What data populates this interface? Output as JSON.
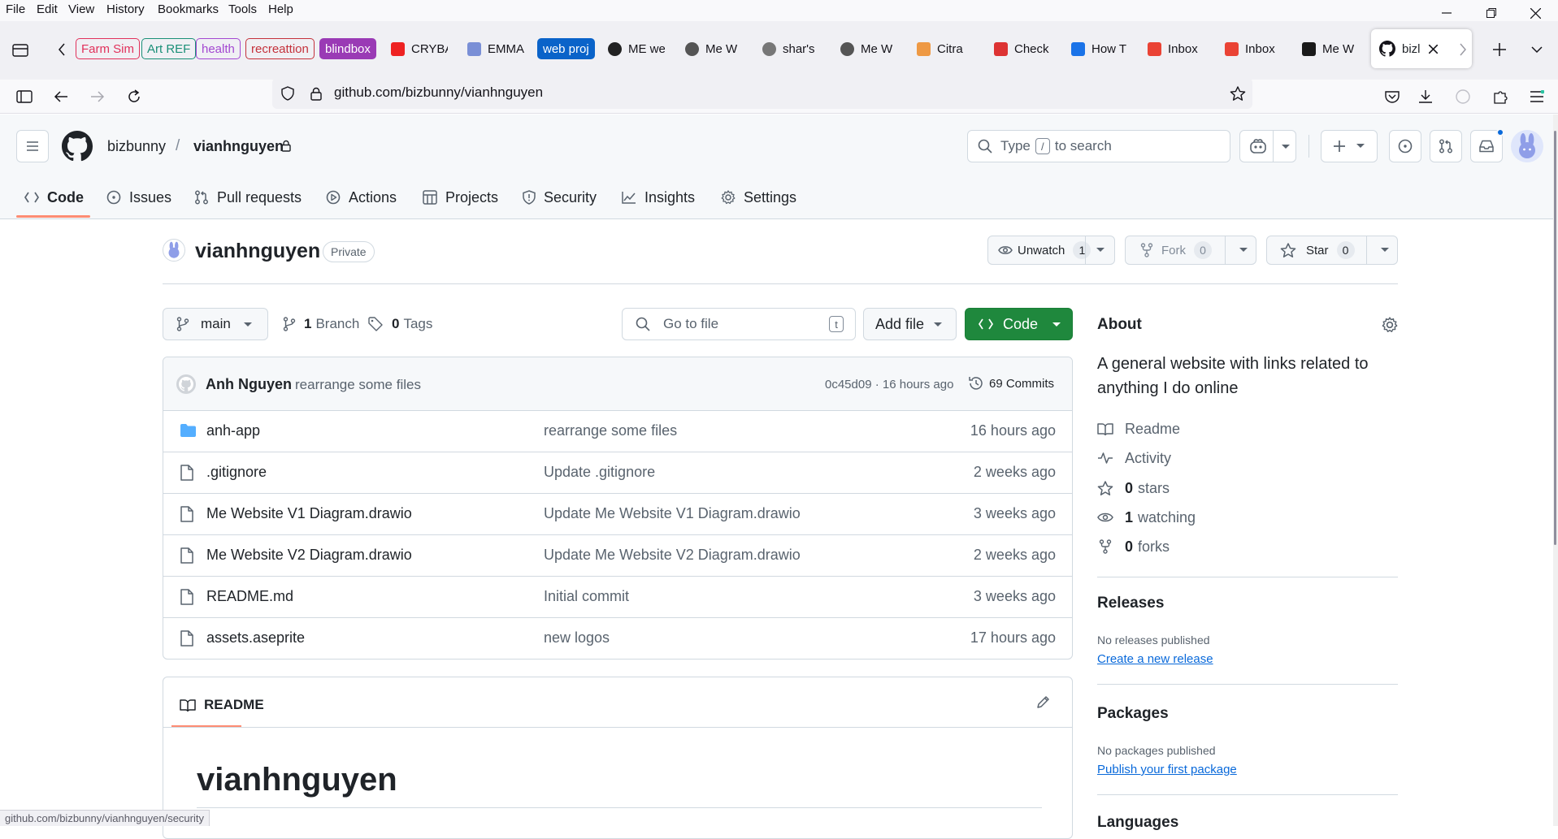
{
  "menu": [
    "File",
    "Edit",
    "View",
    "History",
    "Bookmarks",
    "Tools",
    "Help"
  ],
  "tab_groups": [
    {
      "label": "Farm Sim",
      "color": "#e1315b"
    },
    {
      "label": "Art REF",
      "color": "#1a8f77"
    },
    {
      "label": "health",
      "color": "#a347d1"
    },
    {
      "label": "recreattion",
      "color": "#c4313b"
    },
    {
      "label": "blindbox",
      "color": "#9a3ab5"
    }
  ],
  "tabs": [
    {
      "label": "CRYBA",
      "fav": "#e22"
    },
    {
      "label": "EMMA",
      "fav": "#7a8fd6"
    },
    {
      "label": "ME we",
      "fav": "#222"
    },
    {
      "label": "Me W",
      "fav": "#555"
    },
    {
      "label": "shar's",
      "fav": "#777"
    },
    {
      "label": "Me W",
      "fav": "#555"
    },
    {
      "label": "Citra",
      "fav": "#e94"
    },
    {
      "label": "Check",
      "fav": "#d33"
    },
    {
      "label": "How T",
      "fav": "#1a73e8"
    },
    {
      "label": "Inbox",
      "fav": "#ea4335"
    },
    {
      "label": "Inbox",
      "fav": "#ea4335"
    },
    {
      "label": "Me W",
      "fav": "#1a1a1a"
    }
  ],
  "webproj_group": {
    "label": "web proj",
    "color": "#0a63c9"
  },
  "active_tab": {
    "label": "bizl"
  },
  "url": "github.com/bizbunny/vianhnguyen",
  "status_url": "github.com/bizbunny/vianhnguyen/security",
  "header": {
    "owner": "bizbunny",
    "sep": "/",
    "repo": "vianhnguyen",
    "search_prefix": "Type",
    "search_key": "/",
    "search_suffix": "to search"
  },
  "repo_tabs": [
    "Code",
    "Issues",
    "Pull requests",
    "Actions",
    "Projects",
    "Security",
    "Insights",
    "Settings"
  ],
  "repo": {
    "name": "vianhnguyen",
    "visibility": "Private",
    "unwatch": "Unwatch",
    "watch_count": "1",
    "fork": "Fork",
    "fork_count": "0",
    "star": "Star",
    "star_count": "0"
  },
  "branch_bar": {
    "branch": "main",
    "branch_count": "1",
    "branch_label": "Branch",
    "tag_count": "0",
    "tag_label": "Tags",
    "goto_placeholder": "Go to file",
    "goto_key": "t",
    "add_file": "Add file",
    "code": "Code"
  },
  "commit": {
    "author": "Anh Nguyen",
    "message": "rearrange some files",
    "meta": "0c45d09 · 16 hours ago",
    "commits": "69 Commits"
  },
  "files": [
    {
      "name": "anh-app",
      "type": "folder",
      "message": "rearrange some files",
      "age": "16 hours ago"
    },
    {
      "name": ".gitignore",
      "type": "file",
      "message": "Update .gitignore",
      "age": "2 weeks ago"
    },
    {
      "name": "Me Website V1 Diagram.drawio",
      "type": "file",
      "message": "Update Me Website V1 Diagram.drawio",
      "age": "3 weeks ago"
    },
    {
      "name": "Me Website V2 Diagram.drawio",
      "type": "file",
      "message": "Update Me Website V2 Diagram.drawio",
      "age": "2 weeks ago"
    },
    {
      "name": "README.md",
      "type": "file",
      "message": "Initial commit",
      "age": "3 weeks ago"
    },
    {
      "name": "assets.aseprite",
      "type": "file",
      "message": "new logos",
      "age": "17 hours ago"
    }
  ],
  "readme": {
    "tab": "README",
    "title": "vianhnguyen"
  },
  "about": {
    "title": "About",
    "description_1": "A general website with links related to",
    "description_2": "anything I do online",
    "readme": "Readme",
    "activity": "Activity",
    "stars_count": "0",
    "stars_label": "stars",
    "watching_count": "1",
    "watching_label": "watching",
    "forks_count": "0",
    "forks_label": "forks"
  },
  "releases": {
    "title": "Releases",
    "empty": "No releases published",
    "link": "Create a new release"
  },
  "packages": {
    "title": "Packages",
    "empty": "No packages published",
    "link": "Publish your first package"
  },
  "languages": {
    "title": "Languages"
  },
  "colors": {
    "accent": "#fd8c73",
    "green": "#1f883d",
    "link": "#0969da",
    "folder": "#54aeff"
  }
}
